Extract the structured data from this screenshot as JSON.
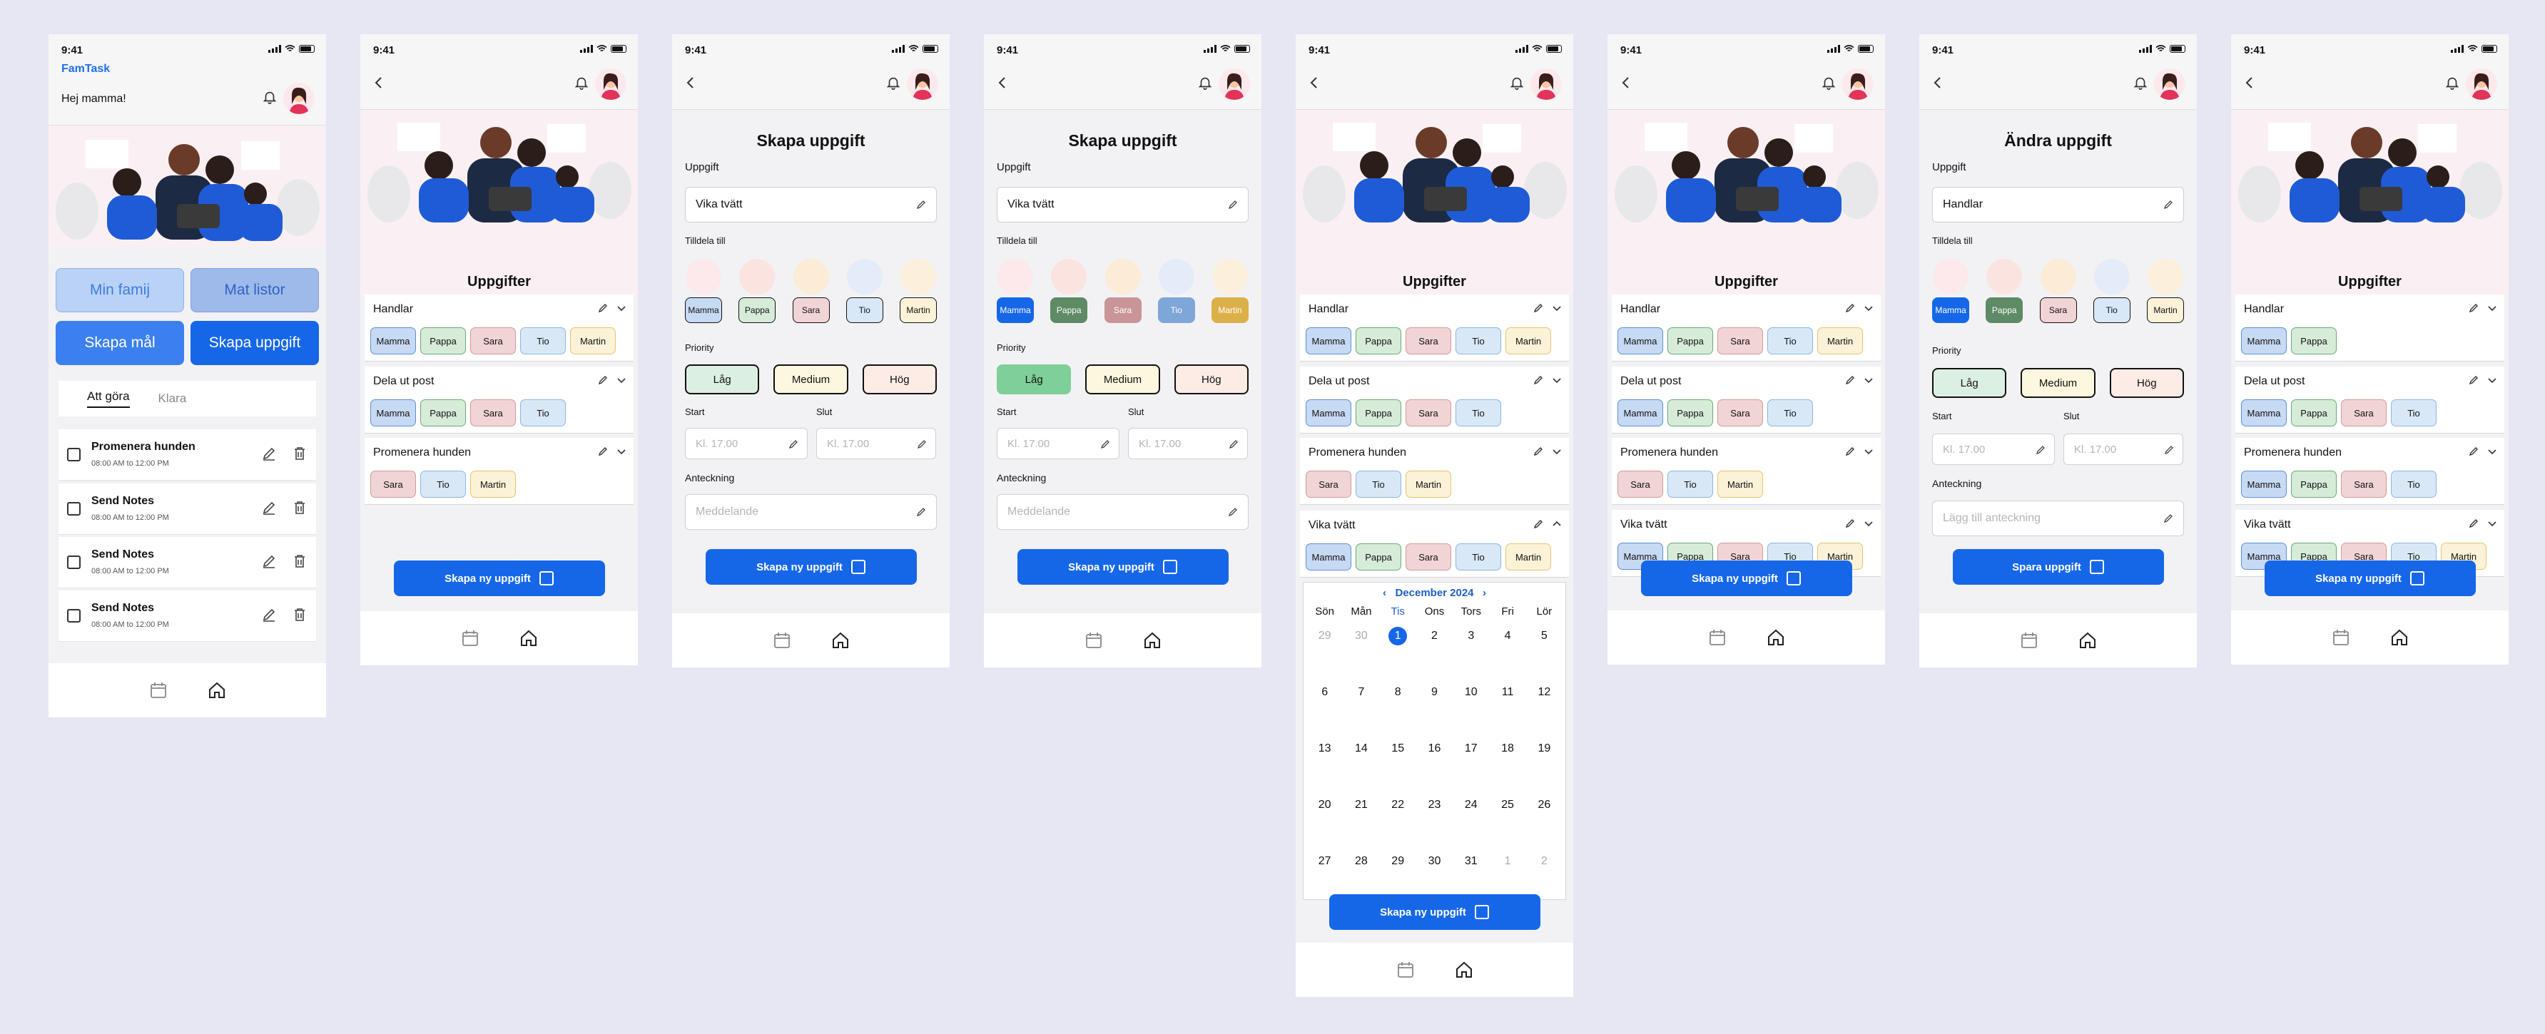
{
  "status_time": "9:41",
  "app": {
    "logo": "FamTask",
    "greeting": "Hej mamma!"
  },
  "home": {
    "buttons": [
      "Min famij",
      "Mat listor",
      "Skapa mål",
      "Skapa uppgift"
    ],
    "tabs": [
      "Att göra",
      "Klara"
    ],
    "tasks": [
      {
        "title": "Promenera hunden",
        "time": "08:00 AM to 12:00 PM"
      },
      {
        "title": "Send Notes",
        "time": "08:00 AM to 12:00 PM"
      },
      {
        "title": "Send Notes",
        "time": "08:00 AM to 12:00 PM"
      },
      {
        "title": "Send Notes",
        "time": "08:00 AM to 12:00 PM"
      }
    ]
  },
  "tasks_title": "Uppgifter",
  "groups": {
    "handlar": "Handlar",
    "dela": "Dela ut post",
    "promenera": "Promenera hunden",
    "vika": "Vika tvätt"
  },
  "members": [
    "Mamma",
    "Pappa",
    "Sara",
    "Tio",
    "Martin"
  ],
  "form": {
    "create_title": "Skapa uppgift",
    "edit_title": "Ändra uppgift",
    "task_label": "Uppgift",
    "task_value": "Vika tvätt",
    "edit_value": "Handlar",
    "assign_label": "Tilldela till",
    "priority_label": "Priority",
    "priorities": [
      "Låg",
      "Medium",
      "Hög"
    ],
    "start_label": "Start",
    "end_label": "Slut",
    "time_placeholder": "Kl. 17.00",
    "note_label": "Anteckning",
    "note_placeholder": "Meddelande",
    "edit_note_placeholder": "Lägg till anteckning"
  },
  "cta": {
    "create": "Skapa ny uppgift",
    "save": "Spara uppgift"
  },
  "calendar": {
    "month": "December 2024",
    "weekdays": [
      "Sön",
      "Mån",
      "Tis",
      "Ons",
      "Tors",
      "Fri",
      "Lör"
    ],
    "days": [
      "29",
      "30",
      "1",
      "2",
      "3",
      "4",
      "5",
      "6",
      "7",
      "8",
      "9",
      "10",
      "11",
      "12",
      "13",
      "14",
      "15",
      "16",
      "17",
      "18",
      "19",
      "20",
      "21",
      "22",
      "23",
      "24",
      "25",
      "26",
      "27",
      "28",
      "29",
      "30",
      "31",
      "1",
      "2"
    ],
    "today_index": 2,
    "muted": [
      0,
      1,
      33,
      34
    ]
  },
  "colors": {
    "accent": "#1667e8",
    "mamma": "#c7daf4",
    "pappa": "#d6ecd9",
    "sara": "#f1d4d6",
    "tio": "#d9e8f7",
    "martin": "#fbf2d8"
  }
}
